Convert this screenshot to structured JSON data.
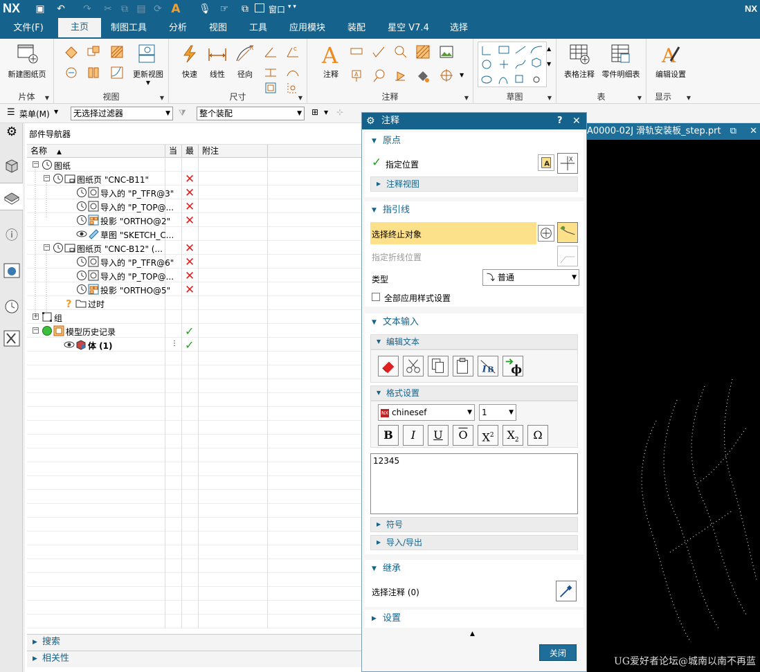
{
  "titlebar": {
    "app_logo": "NX",
    "window_menu": "窗口",
    "right_label": "NX"
  },
  "menu": {
    "tabs": [
      "文件(F)",
      "主页",
      "制图工具",
      "分析",
      "视图",
      "工具",
      "应用模块",
      "装配",
      "星空 V7.4",
      "选择"
    ],
    "active": "主页"
  },
  "ribbon": {
    "groups": [
      {
        "label": "片体",
        "buttons": [
          "新建图纸页"
        ]
      },
      {
        "label": "视图",
        "buttons": [
          "更新视图"
        ]
      },
      {
        "label": "尺寸",
        "buttons": [
          "快速",
          "线性",
          "径向"
        ]
      },
      {
        "label": "注释",
        "buttons": [
          "注释"
        ]
      },
      {
        "label": "草图",
        "buttons": []
      },
      {
        "label": "表",
        "buttons": [
          "表格注释",
          "零件明细表"
        ]
      },
      {
        "label": "显示",
        "buttons": [
          "编辑设置"
        ]
      }
    ]
  },
  "toolbar": {
    "menu_label": "菜单(M)",
    "filter": "无选择过滤器",
    "scope": "整个装配"
  },
  "navigator": {
    "title": "部件导航器",
    "columns": [
      "名称",
      "当",
      "最",
      "附注"
    ],
    "rows": [
      {
        "label": "图纸",
        "status": ""
      },
      {
        "label": "图纸页 \"CNC-B11\"",
        "status": "x"
      },
      {
        "label": "导入的 \"P_TFR@3\"",
        "status": "x"
      },
      {
        "label": "导入的 \"P_TOP@...",
        "status": "x"
      },
      {
        "label": "投影 \"ORTHO@2\"",
        "status": "x"
      },
      {
        "label": "草图 \"SKETCH_C...",
        "status": ""
      },
      {
        "label": "图纸页 \"CNC-B12\" (...",
        "status": "x"
      },
      {
        "label": "导入的 \"P_TFR@6\"",
        "status": "x"
      },
      {
        "label": "导入的 \"P_TOP@...",
        "status": "x"
      },
      {
        "label": "投影 \"ORTHO@5\"",
        "status": "x"
      },
      {
        "label": "过时",
        "status": ""
      },
      {
        "label": "组",
        "status": ""
      },
      {
        "label": "模型历史记录",
        "status": "check"
      },
      {
        "label": "体 (1)",
        "status": "check"
      }
    ],
    "bottom": [
      "搜索",
      "相关性"
    ]
  },
  "viewport": {
    "tab_title": "A0000-02J 滑轨安装板_step.prt",
    "watermark": "UG爱好者论坛@城南以南不再蓝"
  },
  "dialog": {
    "title": "注释",
    "help": "?",
    "origin": {
      "header": "原点",
      "specify": "指定位置",
      "sub": "注释视图"
    },
    "leader": {
      "header": "指引线",
      "select_end": "选择终止对象",
      "polyline": "指定折线位置",
      "type_label": "类型",
      "type_value": "普通",
      "apply_all": "全部应用样式设置"
    },
    "text_input": {
      "header": "文本输入",
      "edit_text": "编辑文本",
      "format": "格式设置",
      "font": "chinesef",
      "font_logo": "NX",
      "size": "1",
      "text": "12345",
      "symbol": "符号",
      "import_export": "导入/导出"
    },
    "inherit": {
      "header": "继承",
      "select_note": "选择注释 (0)"
    },
    "settings": {
      "header": "设置"
    },
    "close_button": "关闭"
  },
  "colors": {
    "brand": "#15638c",
    "highlight": "#fde08a",
    "error": "#e02020",
    "ok": "#20a020"
  }
}
